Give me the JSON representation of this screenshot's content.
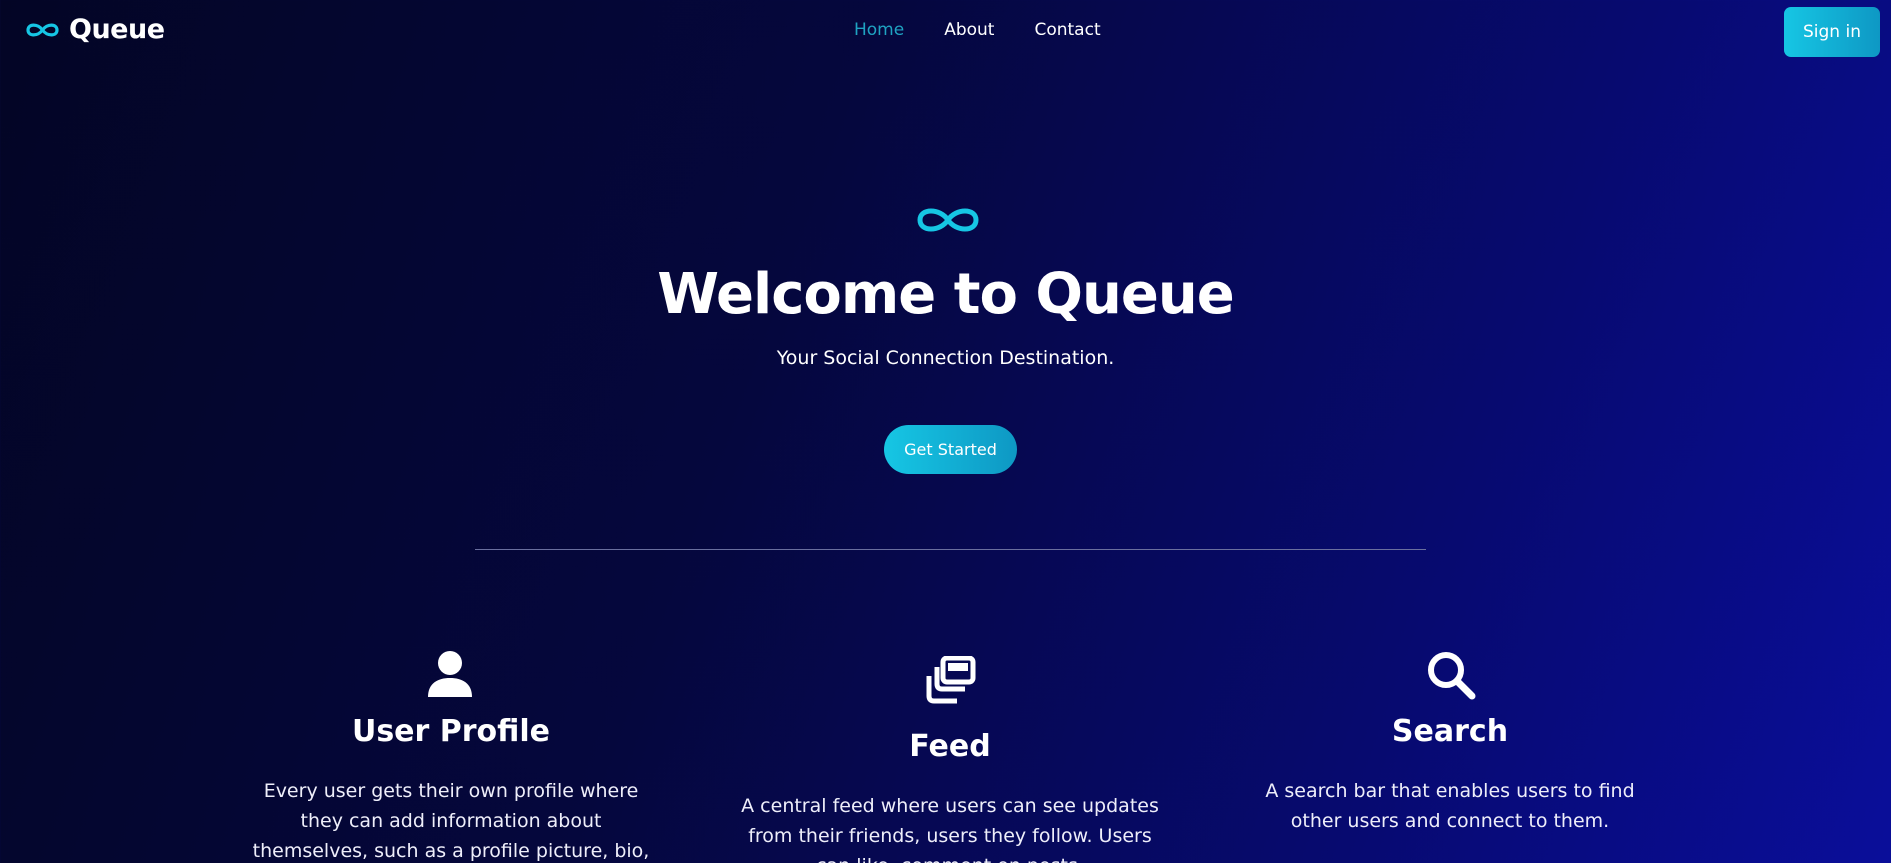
{
  "navbar": {
    "brand": "Queue",
    "links": [
      {
        "label": "Home",
        "active": true
      },
      {
        "label": "About",
        "active": false
      },
      {
        "label": "Contact",
        "active": false
      }
    ],
    "signin_label": "Sign in"
  },
  "hero": {
    "title": "Welcome to Queue",
    "subtitle": "Your Social Connection Destination.",
    "cta_label": "Get Started"
  },
  "features": [
    {
      "icon": "user-icon",
      "title": "User Profile",
      "description": "Every user gets their own profile where they can add information about themselves, such as a profile picture, bio, interests, and contact"
    },
    {
      "icon": "feed-icon",
      "title": "Feed",
      "description": "A central feed where users can see updates from their friends, users they follow. Users can like, comment on posts."
    },
    {
      "icon": "search-icon",
      "title": "Search",
      "description": "A search bar that enables users to find other users and connect to them."
    }
  ],
  "colors": {
    "accent": "#16c6e4",
    "active_link": "#1fa3c2",
    "background_start": "#030525",
    "background_end": "#0a0e9a"
  }
}
